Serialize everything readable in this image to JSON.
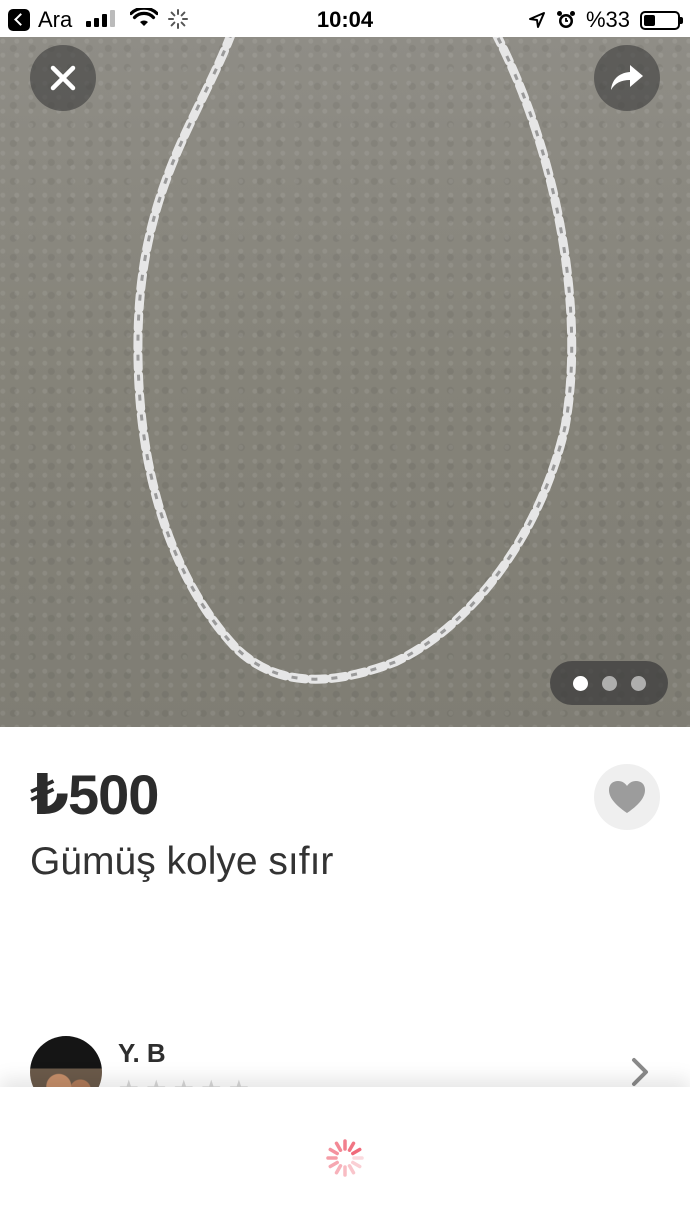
{
  "status_bar": {
    "back_app_label": "Ara",
    "time": "10:04",
    "battery_percent": "%33",
    "battery_level": 0.33,
    "icons": [
      "back-app-icon",
      "signal-icon",
      "wifi-icon",
      "activity-icon",
      "location-arrow-icon",
      "alarm-icon",
      "battery-icon"
    ]
  },
  "gallery": {
    "image_name": "silver-chain-necklace-photo",
    "page_count": 3,
    "current_page": 1,
    "buttons": {
      "close_icon": "close-icon",
      "share_icon": "share-icon"
    }
  },
  "listing": {
    "price": "₺500",
    "title": "Gümüş kolye sıfır",
    "favorite_icon": "heart-icon"
  },
  "seller": {
    "name": "Y. B",
    "rating_stars": 5
  },
  "colors": {
    "spinner_accent": "#f06a7a",
    "text_primary": "#2f2f2f"
  }
}
